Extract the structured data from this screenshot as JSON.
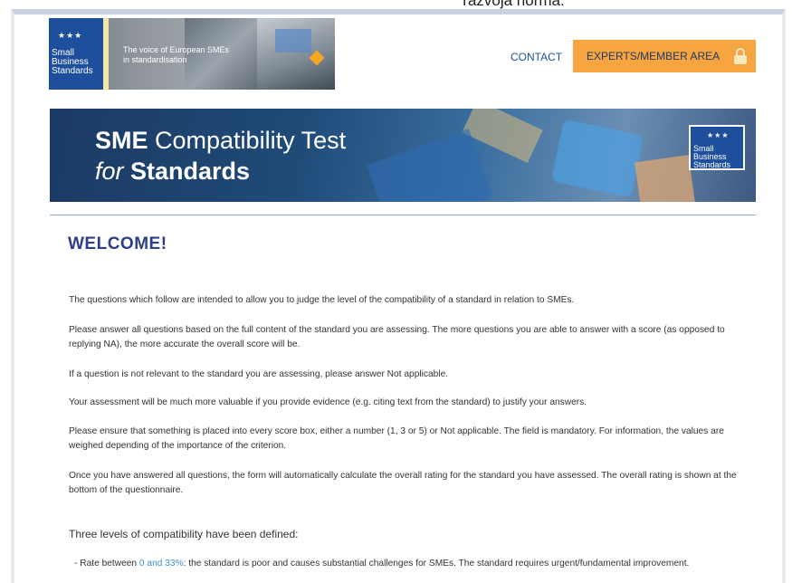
{
  "caption": "razvoja norma.",
  "header": {
    "logo_badge": [
      "Small",
      "Business",
      "Standards"
    ],
    "logo_stars": "★★★",
    "logo_tagline_1": "The voice of European SMEs",
    "logo_tagline_2": "in standardisation",
    "contact_label": "CONTACT",
    "experts_label": "EXPERTS/MEMBER AREA"
  },
  "banner": {
    "title_bold": "SME",
    "title_rest": " Compatibility Test",
    "subtitle_italic": "for",
    "subtitle_bold": " Standards",
    "logo_lines": [
      "Small",
      "Business",
      "Standards"
    ],
    "logo_stars": "★★★"
  },
  "content": {
    "welcome": "WELCOME!",
    "paragraphs": [
      "The questions which follow are intended to allow you to judge the level of the compatibility of a standard in relation to SMEs.",
      "Please answer all questions based on the full content of the standard you are assessing. The more questions you are able to answer with a score (as opposed to replying NA), the more accurate the overall score will be.",
      "If a question is not relevant to the standard you are assessing, please answer Not applicable.",
      "Your assessment will be much more valuable if you provide evidence (e.g. citing text from the standard) to justify your answers.",
      "Please ensure that something is placed into every score box, either a number (1, 3 or 5) or Not applicable. The field is mandatory. For information, the values are weighed depending of the importance of the criterion.",
      "Once you have answered all questions, the form will automatically calculate the overall rating for the standard you have assessed. The overall rating is shown at the bottom of the questionnaire."
    ],
    "levels_heading": "Three levels of compatibility have been defined:",
    "rate_prefix": "- Rate between ",
    "rate_range": "0 and 33%",
    "rate_suffix": ": the standard is poor and causes substantial challenges for SMEs. The standard requires urgent/fundamental improvement."
  },
  "colors": {
    "accent_orange": "#f6a540",
    "brand_blue": "#1d4f9c",
    "heading_blue": "#2d3e8a",
    "link_blue": "#3a8fd1"
  }
}
